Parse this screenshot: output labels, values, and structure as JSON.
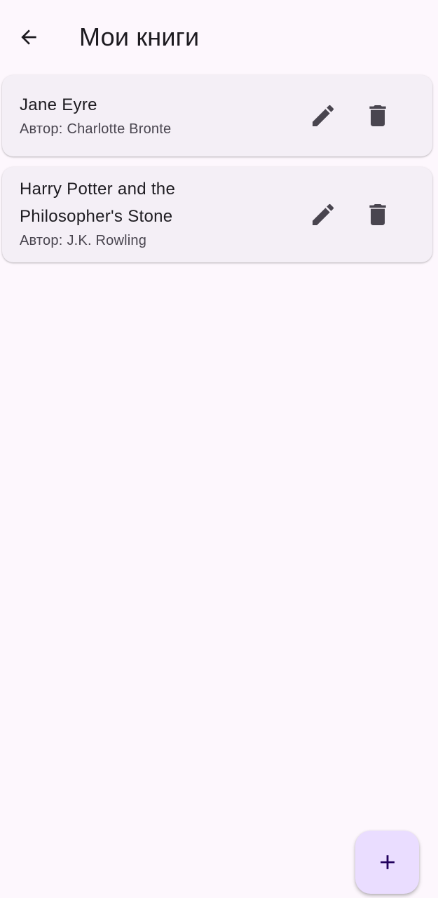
{
  "app_bar": {
    "back_icon": "arrow-back-icon",
    "title": "Мои книги"
  },
  "books": [
    {
      "title": "Jane Eyre",
      "author_prefix": "Автор:",
      "author": "Charlotte Bronte",
      "edit_icon": "pencil-icon",
      "delete_icon": "trash-icon"
    },
    {
      "title": "Harry Potter and the Philosopher's Stone",
      "author_prefix": "Автор:",
      "author": "J.K. Rowling",
      "edit_icon": "pencil-icon",
      "delete_icon": "trash-icon"
    }
  ],
  "fab": {
    "icon": "plus-icon"
  },
  "colors": {
    "background": "#fdf7fd",
    "card": "#f4eff6",
    "icon": "#49454f",
    "fab": "#eaddff",
    "fab_icon": "#21005d"
  }
}
